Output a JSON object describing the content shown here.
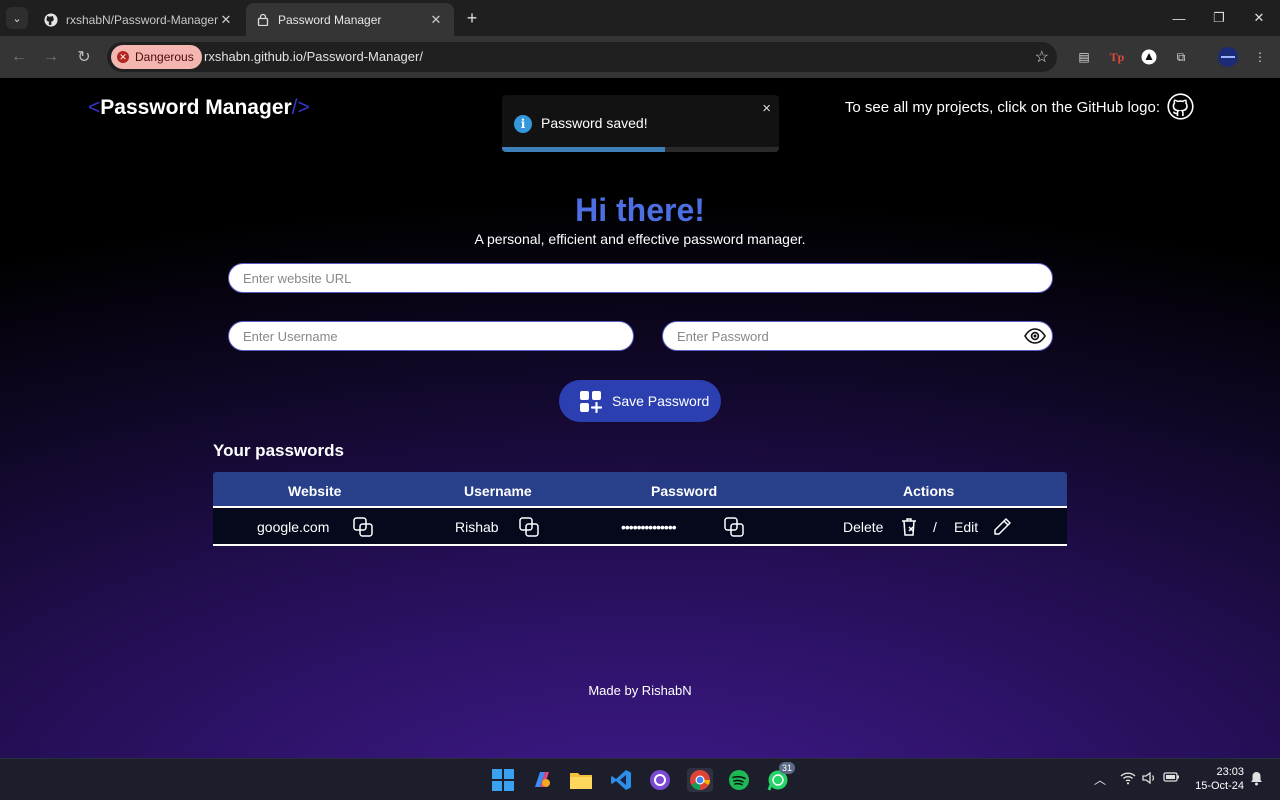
{
  "browser": {
    "tabs": [
      {
        "title": "rxshabN/Password-Manager: C",
        "active": false,
        "icon": "github-icon"
      },
      {
        "title": "Password Manager",
        "active": true,
        "icon": "lock-icon"
      }
    ],
    "security_chip": "Dangerous",
    "url": "rxshabn.github.io/Password-Manager/"
  },
  "header": {
    "logo_open": "<",
    "logo_text": "Password Manager",
    "logo_close": "/>",
    "github_prompt": "To see all my projects, click on the GitHub logo:"
  },
  "toast": {
    "message": "Password saved!",
    "close": "×",
    "progress": 0.59
  },
  "hero": {
    "title": "Hi there!",
    "subtitle": "A personal, efficient and effective password manager."
  },
  "form": {
    "website_placeholder": "Enter website URL",
    "username_placeholder": "Enter Username",
    "password_placeholder": "Enter Password",
    "save_label": "Save Password"
  },
  "passwords": {
    "heading": "Your passwords",
    "columns": [
      "Website",
      "Username",
      "Password",
      "Actions"
    ],
    "rows": [
      {
        "website": "google.com",
        "username": "Rishab",
        "password": "••••••••••••••",
        "delete": "Delete",
        "separator": "/",
        "edit": "Edit"
      }
    ]
  },
  "footer": {
    "text": "Made by RishabN"
  },
  "taskbar": {
    "whatsapp_badge": "31",
    "time": "23:03",
    "date": "15-Oct-24"
  },
  "colors": {
    "accent": "#4d6fe3",
    "button": "#2b3fb0",
    "table_header": "#283f8a",
    "danger": "#f4b6b1"
  }
}
